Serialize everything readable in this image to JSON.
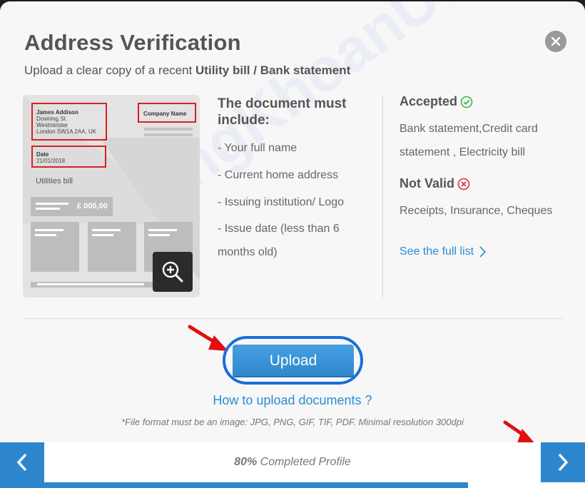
{
  "modal": {
    "title": "Address Verification",
    "subtitle_prefix": "Upload a clear copy of a recent ",
    "subtitle_bold": "Utility bill / Bank statement"
  },
  "sample": {
    "name": "James Addison",
    "address1": "Downing St.",
    "address2": "Westminster",
    "address3": "London SW1A 2AA, UK",
    "date_label": "Date",
    "date_value": "21/01/2018",
    "company": "Company Name",
    "doc_type": "Utilities bill",
    "amount": "£ 000,00"
  },
  "requirements": {
    "title": "The document must include:",
    "items": [
      "- Your full name",
      "- Current home address",
      "- Issuing institution/ Logo",
      "- Issue date (less than 6 months old)"
    ]
  },
  "accepted": {
    "title": "Accepted",
    "text": "Bank statement,Credit card statement , Electricity bill"
  },
  "not_valid": {
    "title": "Not Valid",
    "text": "Receipts, Insurance, Cheques"
  },
  "full_list_link": "See the full list",
  "upload_label": "Upload",
  "how_link": "How to upload documents ?",
  "note": "*File format must be an image: JPG, PNG, GIF, TIF, PDF. Minimal resolution 300dpi",
  "progress": {
    "percent_label": "80%",
    "suffix": " Completed Profile",
    "value": 0.8
  },
  "watermark": "ChungKhoanUSA.com",
  "colors": {
    "accent": "#2e87cc",
    "link": "#2a8ed1",
    "accepted_icon": "#3bb54a",
    "invalid_icon": "#e0303a",
    "annotation_red": "#e01010"
  },
  "icons": [
    "close-icon",
    "zoom-in-icon",
    "check-circle-icon",
    "x-circle-icon",
    "chevron-right-icon",
    "chevron-left-icon",
    "chevron-right-icon"
  ]
}
